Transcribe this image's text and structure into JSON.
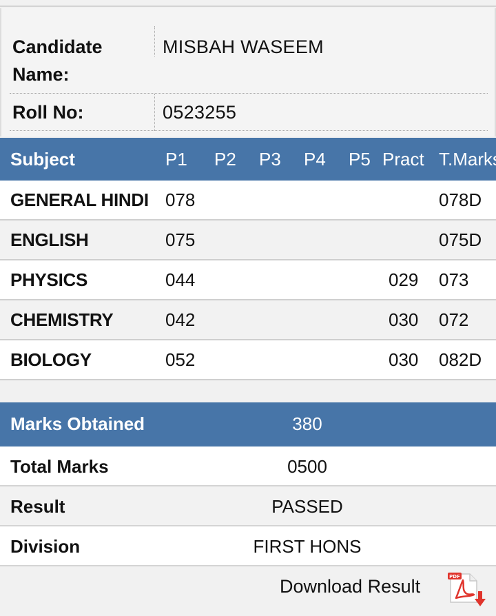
{
  "candidate": {
    "name_label": "Candidate Name:",
    "name_value": "MISBAH WASEEM",
    "roll_label": "Roll No:",
    "roll_value": "0523255"
  },
  "marks_table": {
    "headers": {
      "subject": "Subject",
      "p1": "P1",
      "p2": "P2",
      "p3": "P3",
      "p4": "P4",
      "p5": "P5",
      "pract": "Pract",
      "total": "T.Marks"
    },
    "rows": [
      {
        "subject": "GENERAL HINDI",
        "p1": "078",
        "p2": "",
        "p3": "",
        "p4": "",
        "p5": "",
        "pract": "",
        "total": "078D"
      },
      {
        "subject": "ENGLISH",
        "p1": "075",
        "p2": "",
        "p3": "",
        "p4": "",
        "p5": "",
        "pract": "",
        "total": "075D"
      },
      {
        "subject": "PHYSICS",
        "p1": "044",
        "p2": "",
        "p3": "",
        "p4": "",
        "p5": "",
        "pract": "029",
        "total": "073"
      },
      {
        "subject": "CHEMISTRY",
        "p1": "042",
        "p2": "",
        "p3": "",
        "p4": "",
        "p5": "",
        "pract": "030",
        "total": "072"
      },
      {
        "subject": "BIOLOGY",
        "p1": "052",
        "p2": "",
        "p3": "",
        "p4": "",
        "p5": "",
        "pract": "030",
        "total": "082D"
      }
    ]
  },
  "summary": {
    "marks_obtained_label": "Marks Obtained",
    "marks_obtained_value": "380",
    "total_marks_label": "Total Marks",
    "total_marks_value": "0500",
    "result_label": "Result",
    "result_value": "PASSED",
    "division_label": "Division",
    "division_value": "FIRST HONS"
  },
  "download": {
    "label": "Download Result",
    "icon": "pdf-download-icon",
    "icon_badge": "PDF"
  },
  "colors": {
    "header_blue": "#4775a8",
    "pdf_red": "#e0342c"
  }
}
